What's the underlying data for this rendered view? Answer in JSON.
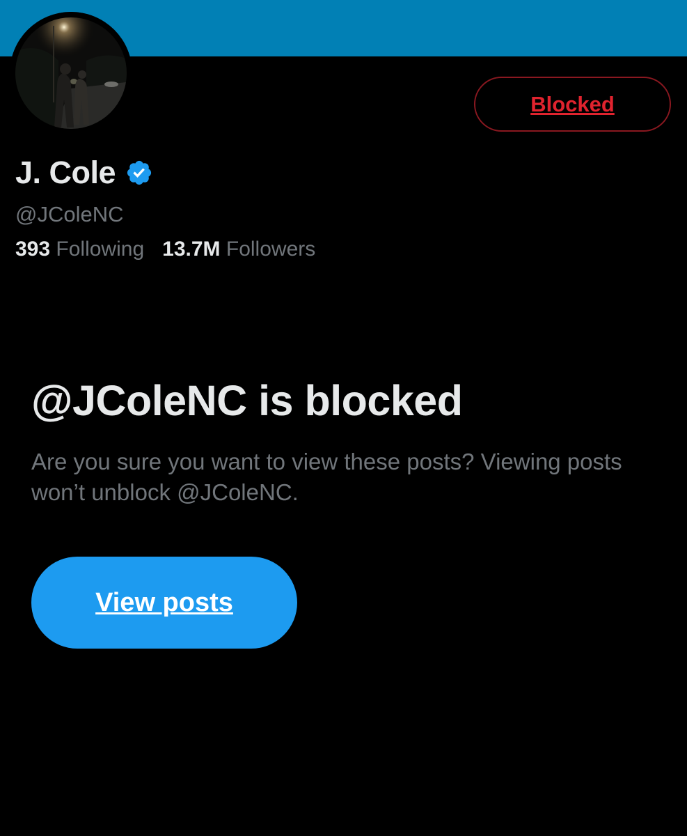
{
  "colors": {
    "banner": "#0180b5",
    "background": "#000000",
    "blocked_text": "#e0232e",
    "primary_button": "#1d9bf0",
    "verified_badge": "#1d9bf0"
  },
  "profile": {
    "display_name": "J. Cole",
    "handle": "@JColeNC",
    "verified": true,
    "verified_icon": "verified-badge-icon",
    "following_count": "393",
    "following_label": "Following",
    "followers_count": "13.7M",
    "followers_label": "Followers"
  },
  "actions": {
    "blocked_label": "Blocked"
  },
  "blocked_notice": {
    "title": "@JColeNC is blocked",
    "body": "Are you sure you want to view these posts? Viewing posts won’t unblock @JColeNC.",
    "view_posts_label": "View posts"
  }
}
